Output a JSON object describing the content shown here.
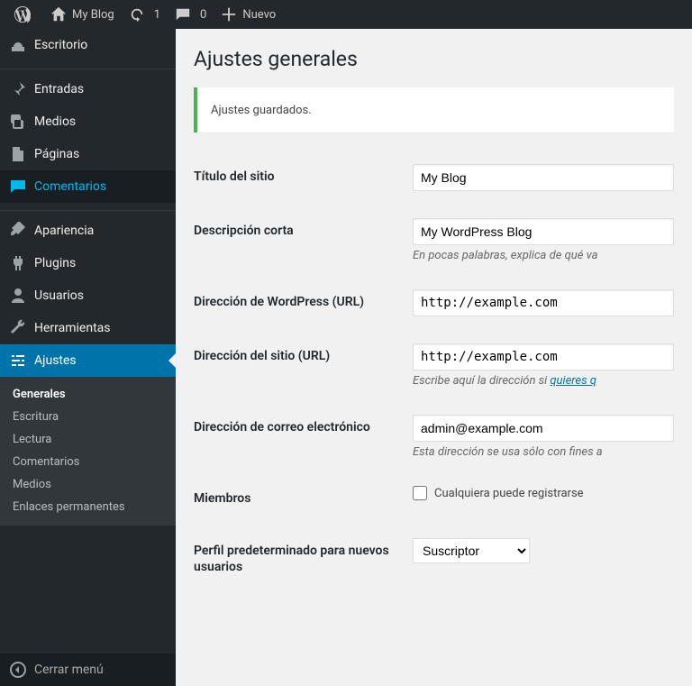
{
  "adminbar": {
    "site_name": "My Blog",
    "updates_count": "1",
    "comments_count": "0",
    "new_label": "Nuevo"
  },
  "sidebar": {
    "items": [
      {
        "label": "Escritorio"
      },
      {
        "label": "Entradas"
      },
      {
        "label": "Medios"
      },
      {
        "label": "Páginas"
      },
      {
        "label": "Comentarios"
      },
      {
        "label": "Apariencia"
      },
      {
        "label": "Plugins"
      },
      {
        "label": "Usuarios"
      },
      {
        "label": "Herramientas"
      },
      {
        "label": "Ajustes"
      }
    ],
    "submenu": [
      "Generales",
      "Escritura",
      "Lectura",
      "Comentarios",
      "Medios",
      "Enlaces permanentes"
    ],
    "collapse": "Cerrar menú"
  },
  "page": {
    "title": "Ajustes generales",
    "notice": "Ajustes guardados."
  },
  "form": {
    "site_title": {
      "label": "Título del sitio",
      "value": "My Blog"
    },
    "tagline": {
      "label": "Descripción corta",
      "value": "My WordPress Blog",
      "help": "En pocas palabras, explica de qué va"
    },
    "wpurl": {
      "label": "Dirección de WordPress (URL)",
      "value": "http://example.com"
    },
    "siteurl": {
      "label": "Dirección del sitio (URL)",
      "value": "http://example.com",
      "help_pre": "Escribe aquí la dirección si ",
      "help_link": "quieres q"
    },
    "email": {
      "label": "Dirección de correo electrónico",
      "value": "admin@example.com",
      "help": "Esta dirección se usa sólo con fines a"
    },
    "membership": {
      "label": "Miembros",
      "checkbox_label": "Cualquiera puede registrarse"
    },
    "default_role": {
      "label": "Perfil predeterminado para nuevos usuarios",
      "selected": "Suscriptor"
    }
  }
}
